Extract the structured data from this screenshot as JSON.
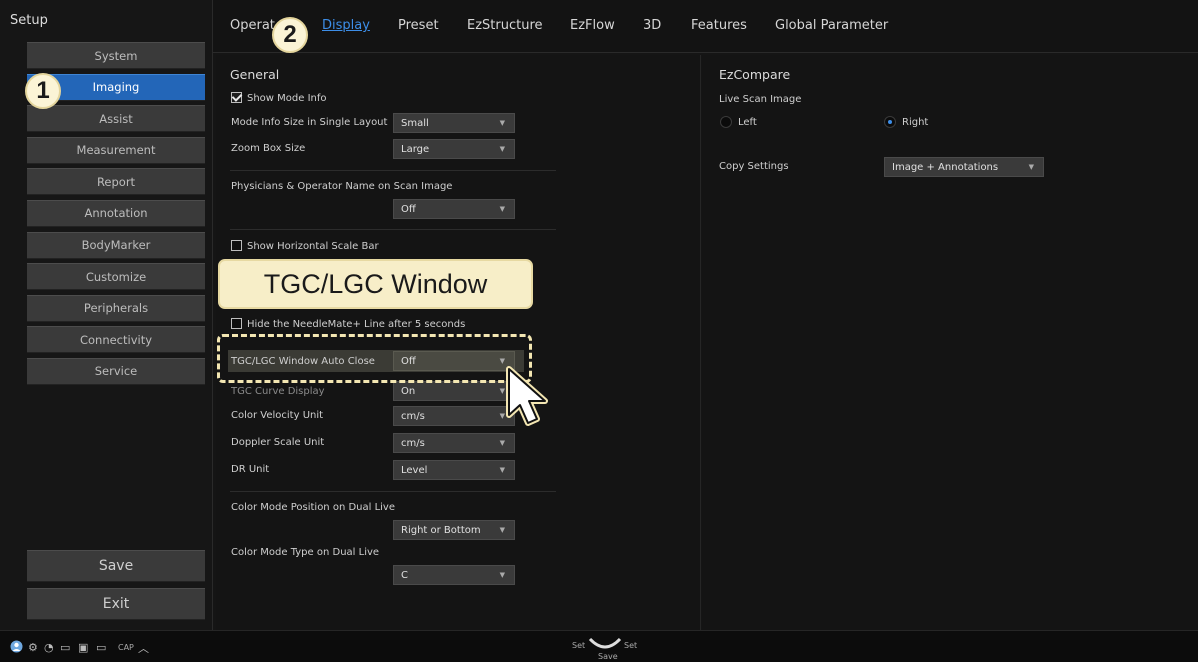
{
  "sidebar": {
    "title": "Setup",
    "items": [
      {
        "label": "System",
        "active": false
      },
      {
        "label": "Imaging",
        "active": true
      },
      {
        "label": "Assist",
        "active": false
      },
      {
        "label": "Measurement",
        "active": false
      },
      {
        "label": "Report",
        "active": false
      },
      {
        "label": "Annotation",
        "active": false
      },
      {
        "label": "BodyMarker",
        "active": false
      },
      {
        "label": "Customize",
        "active": false
      },
      {
        "label": "Peripherals",
        "active": false
      },
      {
        "label": "Connectivity",
        "active": false
      },
      {
        "label": "Service",
        "active": false
      }
    ],
    "save_label": "Save",
    "exit_label": "Exit"
  },
  "tabs": [
    {
      "label": "Operat"
    },
    {
      "label": "Display",
      "active": true
    },
    {
      "label": "Preset"
    },
    {
      "label": "EzStructure"
    },
    {
      "label": "EzFlow"
    },
    {
      "label": "3D"
    },
    {
      "label": "Features"
    },
    {
      "label": "Global Parameter"
    }
  ],
  "general": {
    "heading": "General",
    "show_mode_info": {
      "label": "Show Mode Info",
      "checked": true
    },
    "mode_info_size": {
      "label": "Mode Info Size in Single Layout",
      "value": "Small"
    },
    "zoom_box_size": {
      "label": "Zoom Box Size",
      "value": "Large"
    },
    "physicians_name": {
      "label": "Physicians & Operator Name on Scan Image",
      "value": "Off"
    },
    "show_horizontal_scale": {
      "label": "Show Horizontal Scale Bar",
      "checked": false
    },
    "hide_needlemate": {
      "label": "Hide the NeedleMate+ Line after 5 seconds",
      "checked": false
    },
    "tgc_auto_close": {
      "label": "TGC/LGC Window Auto Close",
      "value": "Off"
    },
    "tgc_curve_display": {
      "label": "TGC Curve Display",
      "value": "On"
    },
    "color_velocity_unit": {
      "label": "Color Velocity Unit",
      "value": "cm/s"
    },
    "doppler_scale_unit": {
      "label": "Doppler Scale Unit",
      "value": "cm/s"
    },
    "dr_unit": {
      "label": "DR Unit",
      "value": "Level"
    },
    "color_mode_position": {
      "label": "Color Mode Position on Dual Live",
      "value": "Right or Bottom"
    },
    "color_mode_type": {
      "label": "Color Mode Type on Dual Live",
      "value": "C"
    }
  },
  "ezcompare": {
    "heading": "EzCompare",
    "live_scan_label": "Live Scan Image",
    "left_label": "Left",
    "right_label": "Right",
    "selected": "Right",
    "copy_settings": {
      "label": "Copy Settings",
      "value": "Image + Annotations"
    }
  },
  "callout": {
    "text": "TGC/LGC Window"
  },
  "badges": {
    "step1": "1",
    "step2": "2"
  },
  "statusbar": {
    "cap_label": "CAP",
    "set_left": "Set",
    "set_right": "Set",
    "save_label": "Save"
  },
  "colors": {
    "accent": "#2366b8",
    "link": "#3d8ee8",
    "callout_bg": "#f7eec8"
  },
  "dropdown_arrow": "▼"
}
